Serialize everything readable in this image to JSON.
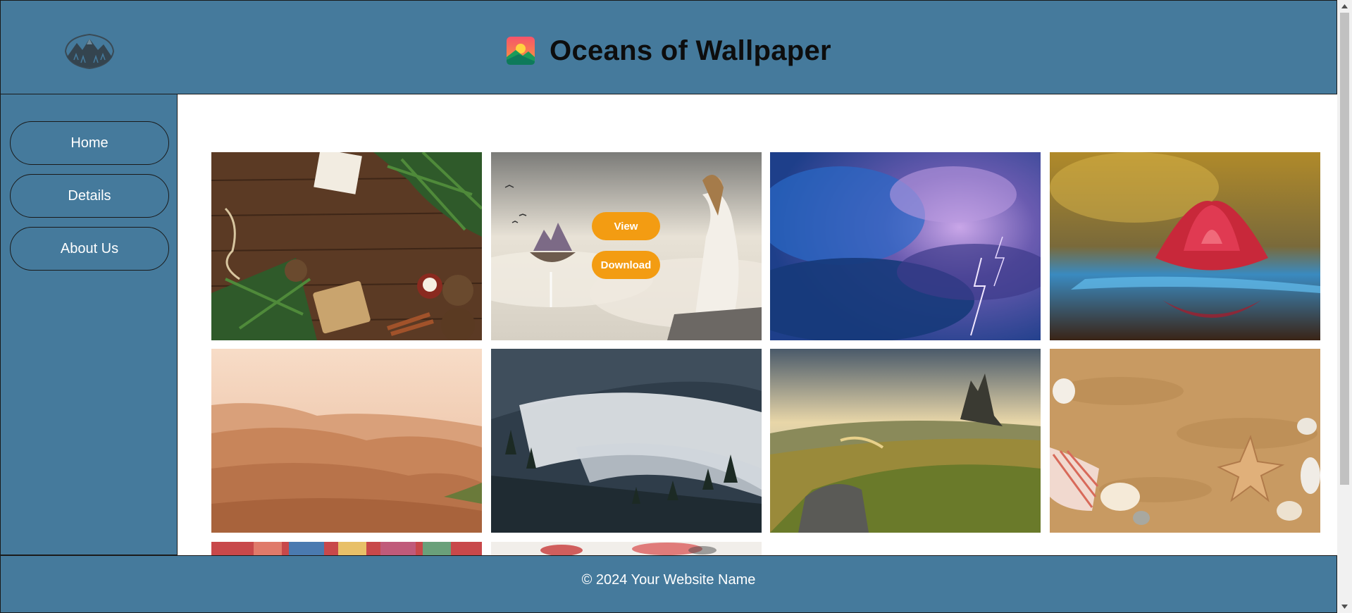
{
  "header": {
    "title": "Oceans of Wallpaper",
    "logo_icon": "mountain-logo-icon",
    "title_icon": "landscape-image-icon"
  },
  "nav": {
    "items": [
      {
        "label": "Home"
      },
      {
        "label": "Details"
      },
      {
        "label": "About Us"
      }
    ]
  },
  "gallery": {
    "hover_actions": {
      "view_label": "View",
      "download_label": "Download"
    },
    "images": [
      {
        "subject": "christmas-flatlay"
      },
      {
        "subject": "fantasy-castle-woman"
      },
      {
        "subject": "storm-clouds"
      },
      {
        "subject": "water-lily"
      },
      {
        "subject": "desert-dunes"
      },
      {
        "subject": "foggy-forest"
      },
      {
        "subject": "mountain-landscape"
      },
      {
        "subject": "beach-seashells"
      },
      {
        "subject": "colorful-wall"
      },
      {
        "subject": "paint-splash"
      }
    ]
  },
  "footer": {
    "text": "© 2024 Your Website Name"
  },
  "colors": {
    "primary": "#457a9c",
    "accent": "#f39c12",
    "border": "#1a1a1a"
  }
}
